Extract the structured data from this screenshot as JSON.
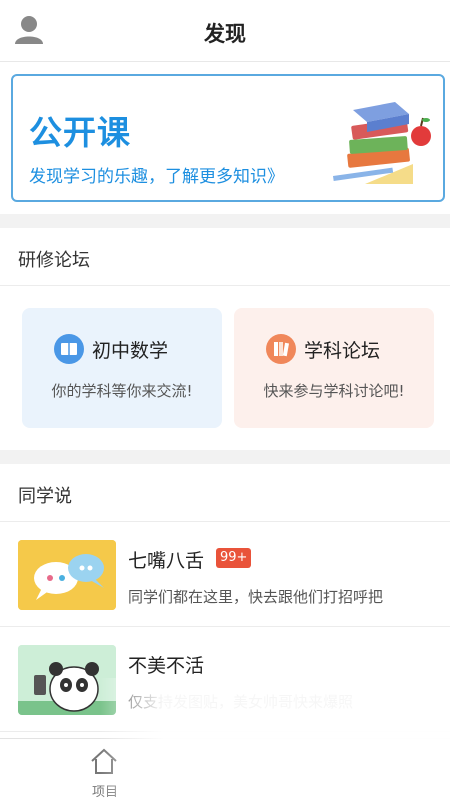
{
  "header": {
    "title": "发现",
    "avatar_icon": "user-icon"
  },
  "banner": {
    "title": "公开课",
    "subtitle": "发现学习的乐趣，了解更多知识》",
    "image_icon": "books-apple-illustration"
  },
  "forum": {
    "section_title": "研修论坛",
    "cards": [
      {
        "title": "初中数学",
        "desc": "你的学科等你来交流!",
        "icon": "book-icon",
        "bg": "#eaf3fc",
        "icon_color": "#4a97e6"
      },
      {
        "title": "学科论坛",
        "desc": "快来参与学科讨论吧!",
        "icon": "books-icon",
        "bg": "#fdf0ec",
        "icon_color": "#f0875a"
      }
    ]
  },
  "classmates": {
    "section_title": "同学说",
    "items": [
      {
        "name": "七嘴八舌",
        "badge": "99+",
        "desc": "同学们都在这里，快去跟他们打招呼把",
        "thumb_icon": "chat-bubbles-icon"
      },
      {
        "name": "不美不活",
        "badge": "",
        "desc": "仅支持发图贴，美女帅哥快来爆照",
        "thumb_icon": "panda-selfie-icon"
      }
    ]
  },
  "tabbar": {
    "home_label": "项目",
    "home_icon": "home-icon"
  },
  "colors": {
    "accent": "#1d8fe0",
    "badge": "#e9533a"
  }
}
